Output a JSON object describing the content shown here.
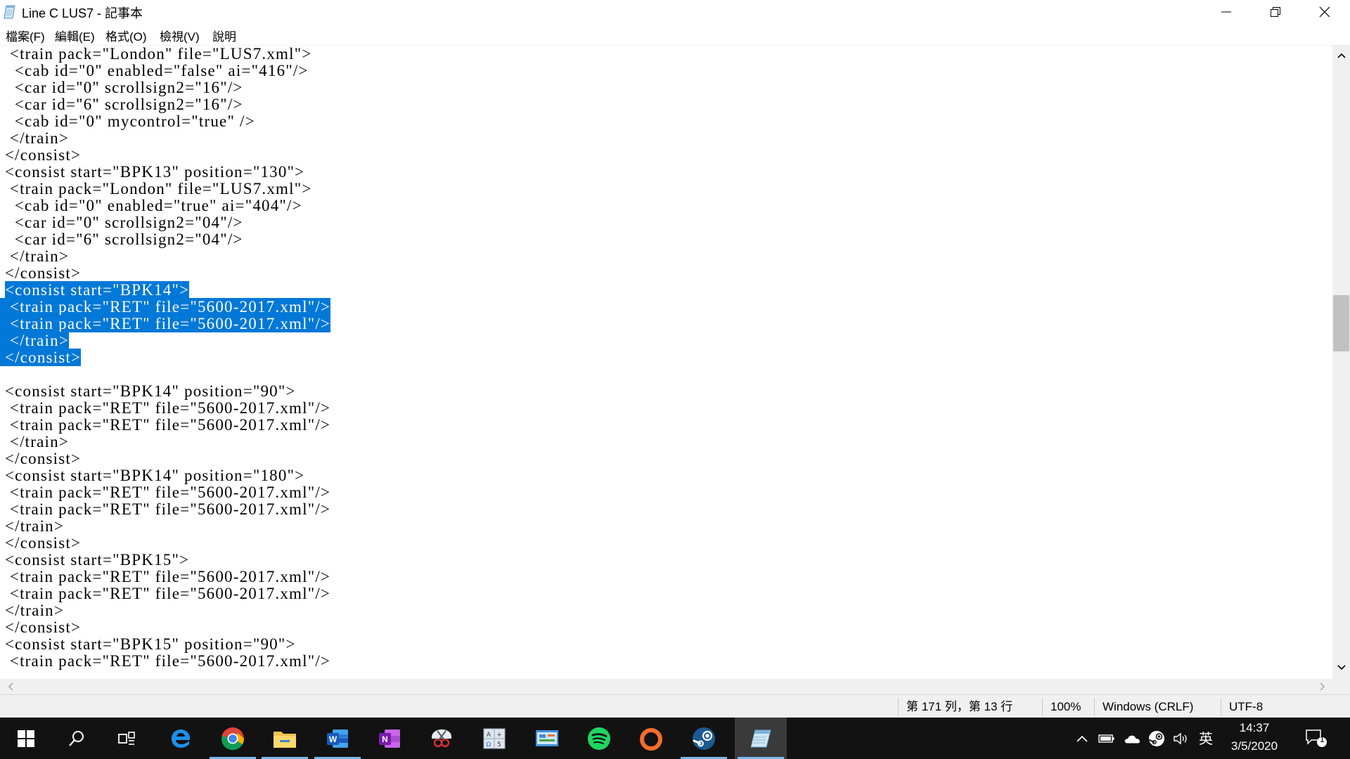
{
  "window": {
    "title": "Line C LUS7 - 記事本",
    "icon": "notepad-icon",
    "controls": [
      "minimize-icon",
      "restore-icon",
      "close-icon"
    ]
  },
  "menu": [
    {
      "label": "檔案(F)"
    },
    {
      "label": "編輯(E)"
    },
    {
      "label": "格式(O)"
    },
    {
      "label": "檢視(V)"
    },
    {
      "label": "說明"
    }
  ],
  "editor": {
    "selection_color": "#0078d7",
    "lines": [
      {
        "indent": "  ",
        "text": "<train pack=\"London\" file=\"LUS7.xml\">",
        "sel": false
      },
      {
        "indent": "   ",
        "text": "<cab id=\"0\" enabled=\"false\" ai=\"416\"/>",
        "sel": false
      },
      {
        "indent": "   ",
        "text": "<car id=\"0\" scrollsign2=\"16\"/>",
        "sel": false
      },
      {
        "indent": "   ",
        "text": "<car id=\"6\" scrollsign2=\"16\"/>",
        "sel": false
      },
      {
        "indent": "   ",
        "text": "<cab id=\"0\" mycontrol=\"true\" />",
        "sel": false
      },
      {
        "indent": "  ",
        "text": "</train>",
        "sel": false
      },
      {
        "indent": " ",
        "text": "</consist>",
        "sel": false
      },
      {
        "indent": " ",
        "text": "<consist start=\"BPK13\" position=\"130\">",
        "sel": false
      },
      {
        "indent": "  ",
        "text": "<train pack=\"London\" file=\"LUS7.xml\">",
        "sel": false
      },
      {
        "indent": "   ",
        "text": "<cab id=\"0\" enabled=\"true\" ai=\"404\"/>",
        "sel": false
      },
      {
        "indent": "   ",
        "text": "<car id=\"0\" scrollsign2=\"04\"/>",
        "sel": false
      },
      {
        "indent": "   ",
        "text": "<car id=\"6\" scrollsign2=\"04\"/>",
        "sel": false
      },
      {
        "indent": "  ",
        "text": "</train>",
        "sel": false
      },
      {
        "indent": " ",
        "text": "</consist>",
        "sel": false
      },
      {
        "indent": " ",
        "text": "<consist start=\"BPK14\">",
        "sel": true
      },
      {
        "indent": "  ",
        "text": "<train pack=\"RET\" file=\"5600-2017.xml\"/>",
        "sel": true
      },
      {
        "indent": "  ",
        "text": "<train pack=\"RET\" file=\"5600-2017.xml\"/>",
        "sel": true
      },
      {
        "indent": "  ",
        "text": "</train>",
        "sel": true
      },
      {
        "indent": " ",
        "text": "</consist>",
        "sel": true
      },
      {
        "indent": "",
        "text": "",
        "sel": false
      },
      {
        "indent": " ",
        "text": "<consist start=\"BPK14\" position=\"90\">",
        "sel": false
      },
      {
        "indent": "  ",
        "text": "<train pack=\"RET\" file=\"5600-2017.xml\"/>",
        "sel": false
      },
      {
        "indent": "  ",
        "text": "<train pack=\"RET\" file=\"5600-2017.xml\"/>",
        "sel": false
      },
      {
        "indent": "  ",
        "text": "</train>",
        "sel": false
      },
      {
        "indent": " ",
        "text": "</consist>",
        "sel": false
      },
      {
        "indent": " ",
        "text": "<consist start=\"BPK14\" position=\"180\">",
        "sel": false
      },
      {
        "indent": "  ",
        "text": "<train pack=\"RET\" file=\"5600-2017.xml\"/>",
        "sel": false
      },
      {
        "indent": "  ",
        "text": "<train pack=\"RET\" file=\"5600-2017.xml\"/>",
        "sel": false
      },
      {
        "indent": " ",
        "text": "</train>",
        "sel": false
      },
      {
        "indent": " ",
        "text": "</consist>",
        "sel": false
      },
      {
        "indent": " ",
        "text": "<consist start=\"BPK15\">",
        "sel": false
      },
      {
        "indent": "  ",
        "text": "<train pack=\"RET\" file=\"5600-2017.xml\"/>",
        "sel": false
      },
      {
        "indent": "  ",
        "text": "<train pack=\"RET\" file=\"5600-2017.xml\"/>",
        "sel": false
      },
      {
        "indent": " ",
        "text": "</train>",
        "sel": false
      },
      {
        "indent": " ",
        "text": "</consist>",
        "sel": false
      },
      {
        "indent": " ",
        "text": "<consist start=\"BPK15\" position=\"90\">",
        "sel": false
      },
      {
        "indent": "  ",
        "text": "<train pack=\"RET\" file=\"5600-2017.xml\"/>",
        "sel": false
      }
    ]
  },
  "status": {
    "position": "第 171 列，第 13 行",
    "zoom": "100%",
    "line_ending": "Windows (CRLF)",
    "encoding": "UTF-8"
  },
  "taskbar": {
    "items": [
      {
        "icon": "windows-start-icon",
        "active": false,
        "running": false
      },
      {
        "icon": "search-icon",
        "active": false,
        "running": false
      },
      {
        "icon": "task-view-icon",
        "active": false,
        "running": false
      },
      {
        "icon": "edge-icon",
        "active": false,
        "running": false
      },
      {
        "icon": "chrome-icon",
        "active": false,
        "running": true
      },
      {
        "icon": "file-explorer-icon",
        "active": false,
        "running": true
      },
      {
        "icon": "word-icon",
        "active": false,
        "running": true
      },
      {
        "icon": "onenote-icon",
        "active": false,
        "running": false
      },
      {
        "icon": "snipping-tool-icon",
        "active": false,
        "running": false
      },
      {
        "icon": "character-map-icon",
        "active": false,
        "running": false
      },
      {
        "icon": "control-panel-icon",
        "active": false,
        "running": false
      },
      {
        "icon": "spotify-icon",
        "active": false,
        "running": false
      },
      {
        "icon": "origin-icon",
        "active": false,
        "running": false
      },
      {
        "icon": "steam-icon",
        "active": false,
        "running": true
      },
      {
        "icon": "notepad-icon",
        "active": true,
        "running": true
      }
    ],
    "tray": {
      "icons": [
        "show-hidden-icons-chevron",
        "battery-icon",
        "onedrive-cloud-icon",
        "steam-tray-icon",
        "volume-icon"
      ],
      "input_method": "英",
      "time": "14:37",
      "date": "3/5/2020",
      "notification_count": "1"
    }
  }
}
